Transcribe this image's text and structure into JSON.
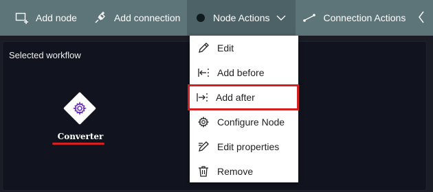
{
  "toolbar": {
    "add_node": {
      "label": "Add node",
      "icon": "add-node-icon"
    },
    "add_connection": {
      "label": "Add connection",
      "icon": "add-connection-icon"
    },
    "node_actions": {
      "label": "Node Actions",
      "icon": "dot-icon"
    },
    "connection_actions": {
      "label": "Connection Actions",
      "icon": "connection-icon"
    },
    "colors": {
      "bg": "#5d7578",
      "active_bg": "#4d6266"
    }
  },
  "panel": {
    "title": "Selected workflow"
  },
  "node": {
    "label": "Converter",
    "icon": "gear-icon",
    "color": "#6b2fbf"
  },
  "node_actions_menu": {
    "items": [
      {
        "label": "Edit",
        "icon": "pencil-icon",
        "highlighted": false
      },
      {
        "label": "Add before",
        "icon": "add-before-icon",
        "highlighted": false
      },
      {
        "label": "Add after",
        "icon": "add-after-icon",
        "highlighted": true
      },
      {
        "label": "Configure Node",
        "icon": "gear-icon",
        "highlighted": false
      },
      {
        "label": "Edit properties",
        "icon": "edit-properties-icon",
        "highlighted": false
      },
      {
        "label": "Remove",
        "icon": "trash-icon",
        "highlighted": false
      }
    ]
  },
  "annotation_color": "#d42020"
}
